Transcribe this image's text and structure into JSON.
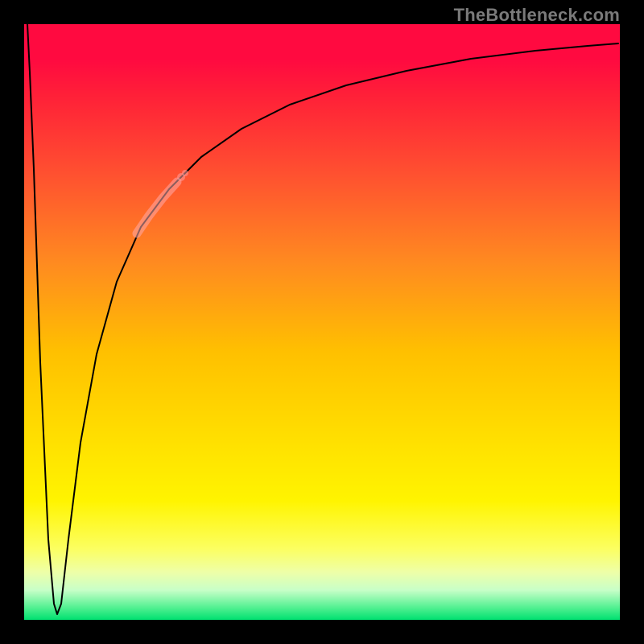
{
  "watermark": "TheBottleneck.com",
  "colors": {
    "frame": "#000000",
    "curve": "#000000",
    "highlight": "rgba(255,170,170,0.55)",
    "gradient_top": "#ff0a40",
    "gradient_bottom": "#00e070"
  },
  "chart_data": {
    "type": "line",
    "title": "",
    "xlabel": "",
    "ylabel": "",
    "xlim": [
      0,
      100
    ],
    "ylim": [
      0,
      100
    ],
    "grid": false,
    "legend": false,
    "x": [
      0,
      1,
      2,
      3,
      4,
      5,
      6,
      7,
      8,
      9,
      10,
      12,
      14,
      16,
      18,
      20,
      22,
      24,
      26,
      28,
      30,
      35,
      40,
      45,
      50,
      55,
      60,
      65,
      70,
      75,
      80,
      85,
      90,
      95,
      100
    ],
    "values": [
      100,
      70,
      40,
      15,
      3,
      1,
      2,
      10,
      20,
      30,
      38,
      48,
      55,
      60,
      64,
      68,
      71,
      74,
      76,
      78,
      80,
      84,
      86.5,
      88.5,
      90,
      91,
      92,
      92.8,
      93.5,
      94,
      94.5,
      95,
      95.3,
      95.6,
      95.8
    ],
    "highlight_region": {
      "x_start": 16,
      "x_end": 23,
      "note": "emphasized segment on rising part of curve"
    },
    "background_gradient": "red (top) → orange → yellow → pale yellow → green (bottom)"
  }
}
